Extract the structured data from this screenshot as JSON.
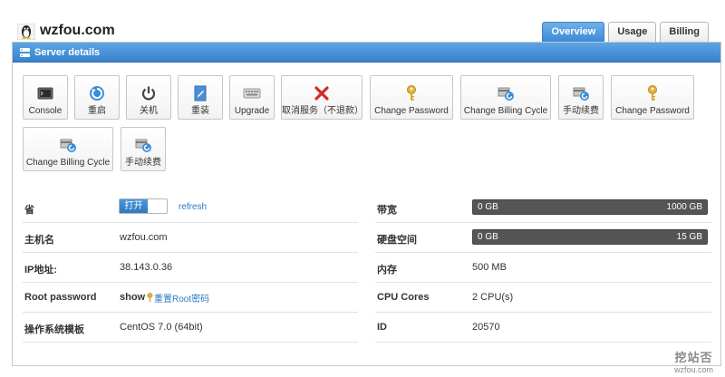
{
  "site": {
    "title": "wzfou.com",
    "logo_icon": "tux-icon"
  },
  "tabs": [
    {
      "label": "Overview",
      "active": true
    },
    {
      "label": "Usage",
      "active": false
    },
    {
      "label": "Billing",
      "active": false
    }
  ],
  "panel": {
    "title": "Server details",
    "icon": "server-icon"
  },
  "actions": [
    {
      "label": "Console",
      "icon": "terminal-icon"
    },
    {
      "label": "重启",
      "icon": "restart-icon"
    },
    {
      "label": "关机",
      "icon": "power-icon"
    },
    {
      "label": "重装",
      "icon": "reinstall-icon"
    },
    {
      "label": "Upgrade",
      "icon": "keyboard-icon"
    },
    {
      "label": "取消服务（不退款）",
      "icon": "cancel-icon"
    },
    {
      "label": "Change Password",
      "icon": "key-icon"
    },
    {
      "label": "Change Billing Cycle",
      "icon": "billing-cycle-icon"
    },
    {
      "label": "手动续费",
      "icon": "renew-icon"
    },
    {
      "label": "Change Password",
      "icon": "key-icon"
    },
    {
      "label": "Change Billing Cycle",
      "icon": "billing-cycle-icon"
    },
    {
      "label": "手动续费",
      "icon": "renew-icon"
    }
  ],
  "details_left": {
    "province": {
      "label": "省",
      "toggle_label": "打开",
      "refresh_label": "refresh"
    },
    "hostname": {
      "label": "主机名",
      "value": "wzfou.com"
    },
    "ip": {
      "label": "IP地址:",
      "value": "38.143.0.36"
    },
    "root_password": {
      "label": "Root password",
      "show_label": "show",
      "reset_label": "重置Root密码"
    },
    "os": {
      "label": "操作系统模板",
      "value": "CentOS 7.0 (64bit)"
    }
  },
  "details_right": {
    "bandwidth": {
      "label": "带宽",
      "used": "0 GB",
      "total": "1000 GB",
      "used_fraction": 0
    },
    "disk": {
      "label": "硬盘空间",
      "used": "0 GB",
      "total": "15 GB",
      "used_fraction": 0
    },
    "memory": {
      "label": "内存",
      "value": "500 MB"
    },
    "cpu": {
      "label": "CPU Cores",
      "value": "2 CPU(s)"
    },
    "id": {
      "label": "ID",
      "value": "20570"
    }
  },
  "watermark": {
    "cn": "挖站否",
    "en": "wzfou.com"
  },
  "colors": {
    "accent": "#3c8ad6",
    "danger": "#d9242b",
    "link": "#2a7ac4",
    "bar": "#555555"
  }
}
